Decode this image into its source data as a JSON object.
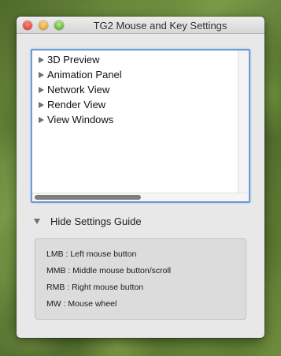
{
  "window": {
    "title": "TG2 Mouse and Key Settings"
  },
  "tree": {
    "items": [
      {
        "label": "3D Preview"
      },
      {
        "label": "Animation Panel"
      },
      {
        "label": "Network View"
      },
      {
        "label": "Render View"
      },
      {
        "label": "View Windows"
      }
    ],
    "hscroll_position": 0,
    "selection_accent": "#6c9bd8"
  },
  "guide": {
    "toggle_label": "Hide Settings Guide",
    "lines": [
      "LMB : Left mouse button",
      "MMB : Middle mouse button/scroll",
      "RMB : Right mouse button",
      "MW : Mouse wheel"
    ]
  },
  "icons": {
    "close": "close-icon",
    "minimize": "minimize-icon",
    "zoom": "zoom-icon",
    "disclosure": "disclosure-triangle-icon",
    "collapse": "collapse-triangle-icon"
  }
}
